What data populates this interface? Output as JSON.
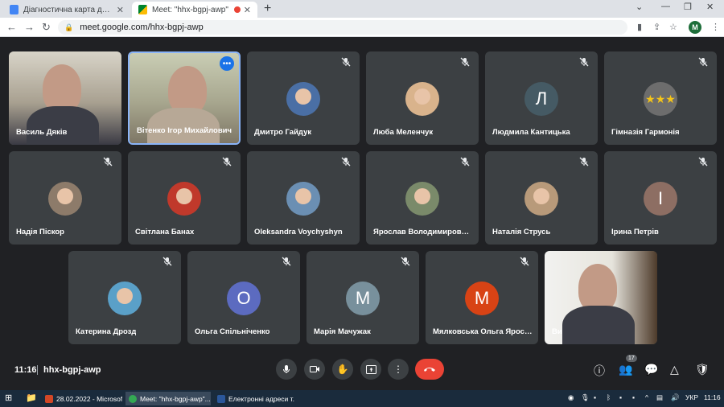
{
  "browser": {
    "tabs": [
      {
        "title": "Діагностична карта для педагогі",
        "active": false
      },
      {
        "title": "Meet: \"hhx-bgpj-awp\"",
        "active": true
      }
    ],
    "url": "meet.google.com/hhx-bgpj-awp",
    "profile_initial": "M"
  },
  "participants": [
    {
      "name": "Василь Дяків",
      "kind": "video",
      "muted": false
    },
    {
      "name": "Вітенко Ігор Михайлович",
      "kind": "video",
      "muted": false,
      "speaking": true
    },
    {
      "name": "Дмитро Гайдук",
      "kind": "photo",
      "muted": true,
      "color": "#4a6fa5"
    },
    {
      "name": "Люба Меленчук",
      "kind": "photo",
      "muted": true,
      "color": "#d9b38c"
    },
    {
      "name": "Людмила Кантицька",
      "kind": "letter",
      "letter": "Л",
      "muted": true,
      "color": "#455a64"
    },
    {
      "name": "Гімназія Гармонія",
      "kind": "logo",
      "muted": true,
      "color": "#6d6d6d"
    },
    {
      "name": "Надія Піскор",
      "kind": "photo",
      "muted": true,
      "color": "#8d7b6a"
    },
    {
      "name": "Світлана Банах",
      "kind": "photo",
      "muted": true,
      "color": "#c0392b"
    },
    {
      "name": "Oleksandra Voychyshyn",
      "kind": "photo",
      "muted": true,
      "color": "#6b8fb3"
    },
    {
      "name": "Ярослав Володимирович …",
      "kind": "photo",
      "muted": true,
      "color": "#7a8a6a"
    },
    {
      "name": "Наталія Струсь",
      "kind": "photo",
      "muted": true,
      "color": "#b89a7a"
    },
    {
      "name": "Ірина Петрів",
      "kind": "letter",
      "letter": "І",
      "muted": true,
      "color": "#8d6e63"
    },
    {
      "name": "Катерина Дрозд",
      "kind": "photo",
      "muted": true,
      "color": "#5aa0c8"
    },
    {
      "name": "Ольга Спільніченко",
      "kind": "letter",
      "letter": "О",
      "muted": true,
      "color": "#5c6bc0"
    },
    {
      "name": "Марія Мачужак",
      "kind": "letter",
      "letter": "М",
      "muted": true,
      "color": "#78909c"
    },
    {
      "name": "Мялковська Ольга Ярослі…",
      "kind": "letter",
      "letter": "М",
      "muted": true,
      "color": "#d84315"
    },
    {
      "name": "Ви",
      "kind": "video",
      "muted": false
    }
  ],
  "controls": {
    "time": "11:16",
    "meeting_code": "hhx-bgpj-awp",
    "people_count": "17"
  },
  "taskbar": {
    "items": [
      "28.02.2022 - Microsof...",
      "Meet: \"hhx-bgpj-awp\"...",
      "Електронні адреси т..."
    ],
    "lang": "УКР",
    "time": "11:16"
  }
}
